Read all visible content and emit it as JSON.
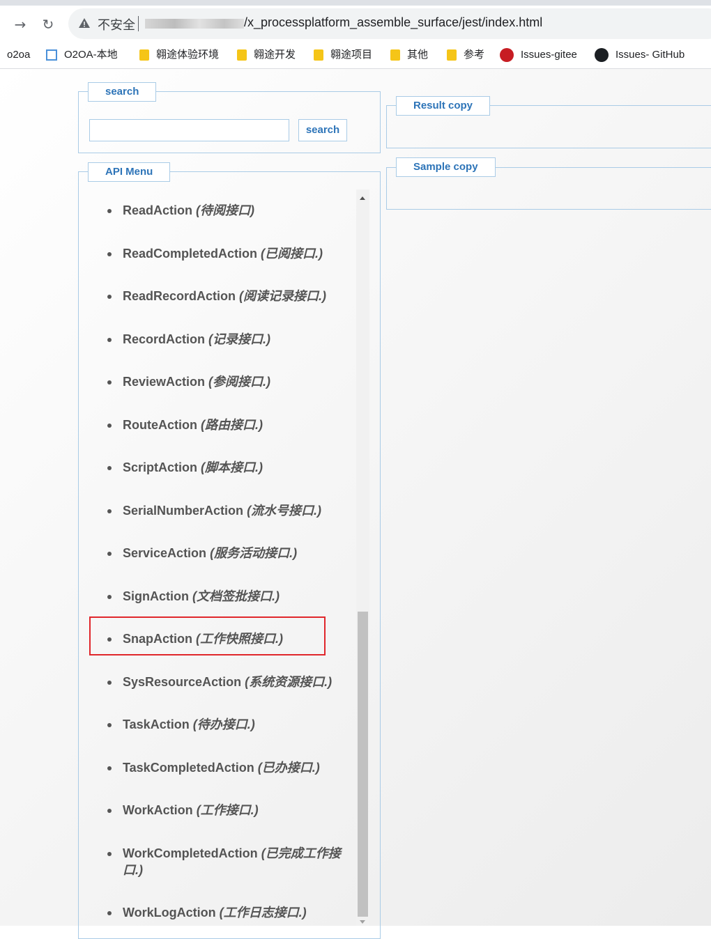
{
  "browser": {
    "insecure_label": "不安全",
    "url": "/x_processplatform_assemble_surface/jest/index.html",
    "bookmarks": [
      {
        "label": "o2oa",
        "icon": "none"
      },
      {
        "label": "O2OA-本地",
        "icon": "o2oa-icon"
      },
      {
        "label": "翱途体验环境",
        "icon": "folder-icon"
      },
      {
        "label": "翱途开发",
        "icon": "folder-icon"
      },
      {
        "label": "翱途项目",
        "icon": "folder-icon"
      },
      {
        "label": "其他",
        "icon": "folder-icon"
      },
      {
        "label": "参考",
        "icon": "folder-icon"
      },
      {
        "label": "Issues-gitee",
        "icon": "gitee-icon"
      },
      {
        "label": "Issues- GitHub",
        "icon": "github-icon"
      }
    ]
  },
  "search_panel": {
    "legend": "search",
    "input_value": "",
    "button_label": "search"
  },
  "result_panel": {
    "legend": "Result copy"
  },
  "sample_panel": {
    "legend": "Sample copy"
  },
  "api_menu": {
    "legend": "API Menu",
    "items": [
      {
        "name": "ReadAction",
        "desc": "(待阅接口)"
      },
      {
        "name": "ReadCompletedAction",
        "desc": "(已阅接口.)"
      },
      {
        "name": "ReadRecordAction",
        "desc": "(阅读记录接口.)"
      },
      {
        "name": "RecordAction",
        "desc": "(记录接口.)"
      },
      {
        "name": "ReviewAction",
        "desc": "(参阅接口.)"
      },
      {
        "name": "RouteAction",
        "desc": "(路由接口.)"
      },
      {
        "name": "ScriptAction",
        "desc": "(脚本接口.)"
      },
      {
        "name": "SerialNumberAction",
        "desc": "(流水号接口.)"
      },
      {
        "name": "ServiceAction",
        "desc": "(服务活动接口.)"
      },
      {
        "name": "SignAction",
        "desc": "(文档签批接口.)"
      },
      {
        "name": "SnapAction",
        "desc": "(工作快照接口.)"
      },
      {
        "name": "SysResourceAction",
        "desc": "(系统资源接口.)"
      },
      {
        "name": "TaskAction",
        "desc": "(待办接口.)"
      },
      {
        "name": "TaskCompletedAction",
        "desc": "(已办接口.)"
      },
      {
        "name": "WorkAction",
        "desc": "(工作接口.)"
      },
      {
        "name": "WorkCompletedAction",
        "desc": "(已完成工作接口.)"
      },
      {
        "name": "WorkLogAction",
        "desc": "(工作日志接口.)"
      }
    ],
    "highlighted_item": "SnapAction",
    "highlight_color": "#e0262b"
  },
  "colors": {
    "accent": "#2d74b8",
    "border": "#a9cbe6"
  }
}
